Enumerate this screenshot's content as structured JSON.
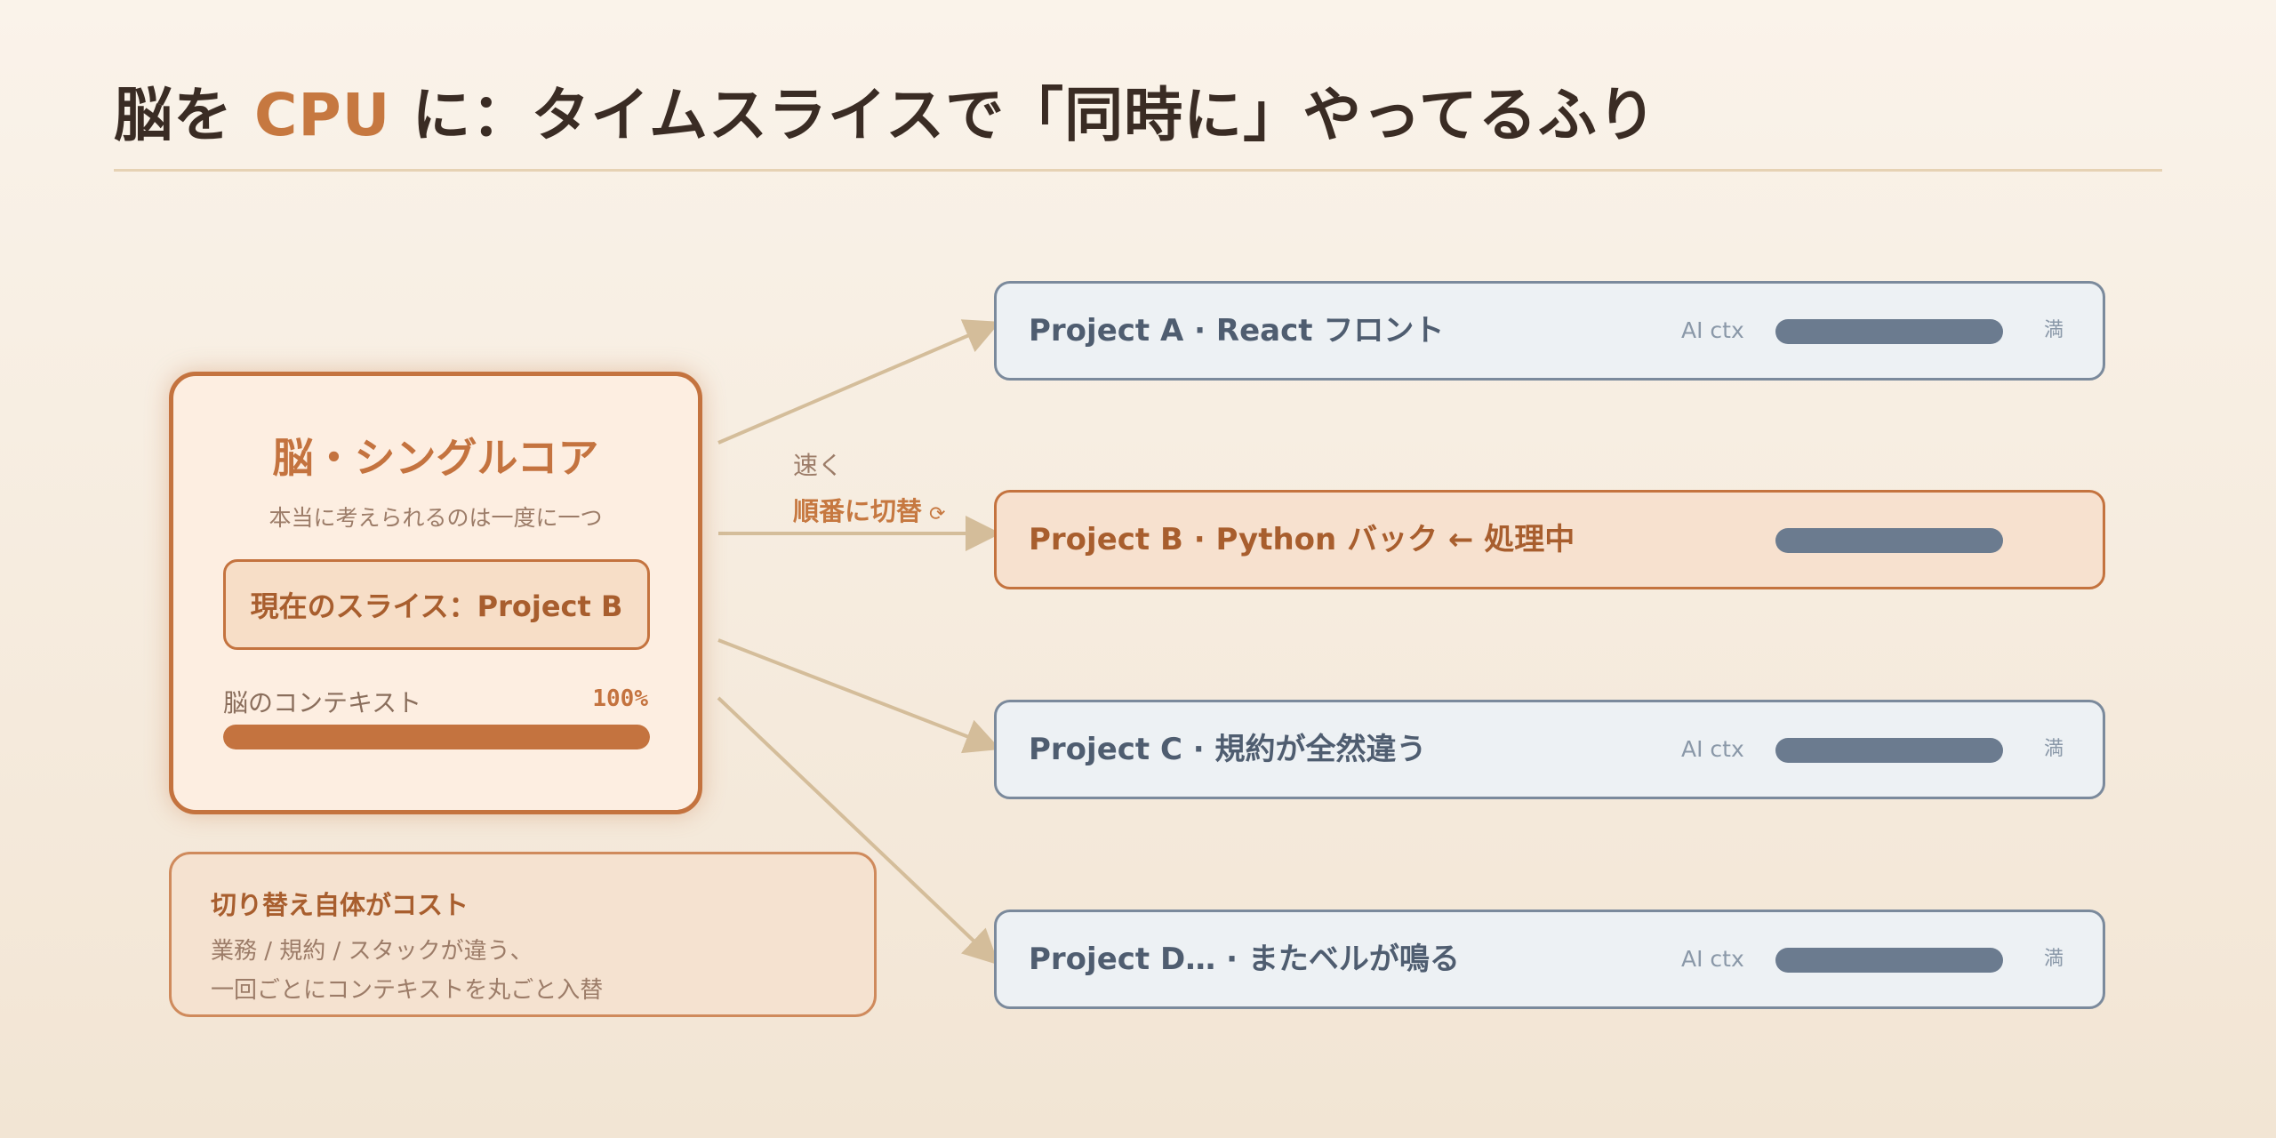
{
  "title": {
    "part1": "脳を ",
    "accent": "CPU",
    "part2": " に：タイムスライスで「同時に」やってるふり"
  },
  "brain": {
    "title": "脳・シングルコア",
    "subtitle": "本当に考えられるのは一度に一つ",
    "slice_label": "現在のスライス：Project B",
    "context_label": "脳のコンテキスト",
    "context_value": "100%",
    "context_fill_percent": 100
  },
  "switch_note": {
    "line1": "速く",
    "line2": "順番に切替",
    "cycle_icon": "⟳"
  },
  "cost_box": {
    "title": "切り替え自体がコスト",
    "line1": "業務 / 規約 / スタックが違う、",
    "line2": "一回ごとにコンテキストを丸ごと入替"
  },
  "projects": [
    {
      "name": "Project A · React フロント",
      "ctx_label": "AI ctx",
      "status": "満",
      "active": false
    },
    {
      "name": "Project B · Python バック ← 処理中",
      "ctx_label": "",
      "status": "",
      "active": true
    },
    {
      "name": "Project C · 規約が全然違う",
      "ctx_label": "AI ctx",
      "status": "満",
      "active": false
    },
    {
      "name": "Project D… · またベルが鳴る",
      "ctx_label": "AI ctx",
      "status": "満",
      "active": false
    }
  ],
  "colors": {
    "accent": "#c4733f",
    "title_text": "#3a2c24",
    "project_border": "#7b8a9c",
    "project_bar": "#6b7b8f",
    "arrow": "#d4bd9a"
  }
}
